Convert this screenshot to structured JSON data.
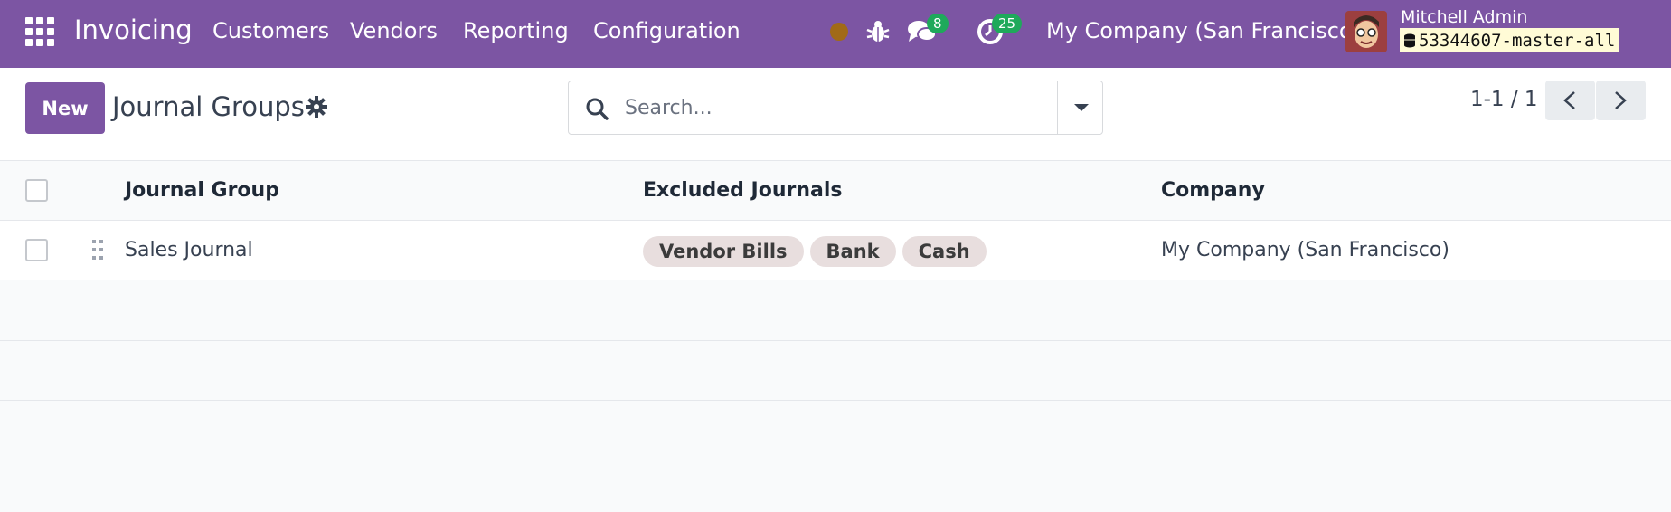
{
  "navbar": {
    "app_name": "Invoicing",
    "menus": [
      "Customers",
      "Vendors",
      "Reporting",
      "Configuration"
    ],
    "messages_count": "8",
    "activities_count": "25",
    "company": "My Company (San Francisco)",
    "user_name": "Mitchell Admin",
    "database": "53344607-master-all"
  },
  "control": {
    "new_label": "New",
    "title": "Journal Groups",
    "search_placeholder": "Search...",
    "pager": "1-1 / 1"
  },
  "list": {
    "columns": [
      "Journal Group",
      "Excluded Journals",
      "Company"
    ],
    "rows": [
      {
        "journal_group": "Sales Journal",
        "excluded_journals": [
          "Vendor Bills",
          "Bank",
          "Cash"
        ],
        "company": "My Company (San Francisco)"
      }
    ]
  },
  "colors": {
    "brand": "#7c55a3",
    "badge": "#1fa95b",
    "tag_bg": "#e8dede"
  }
}
